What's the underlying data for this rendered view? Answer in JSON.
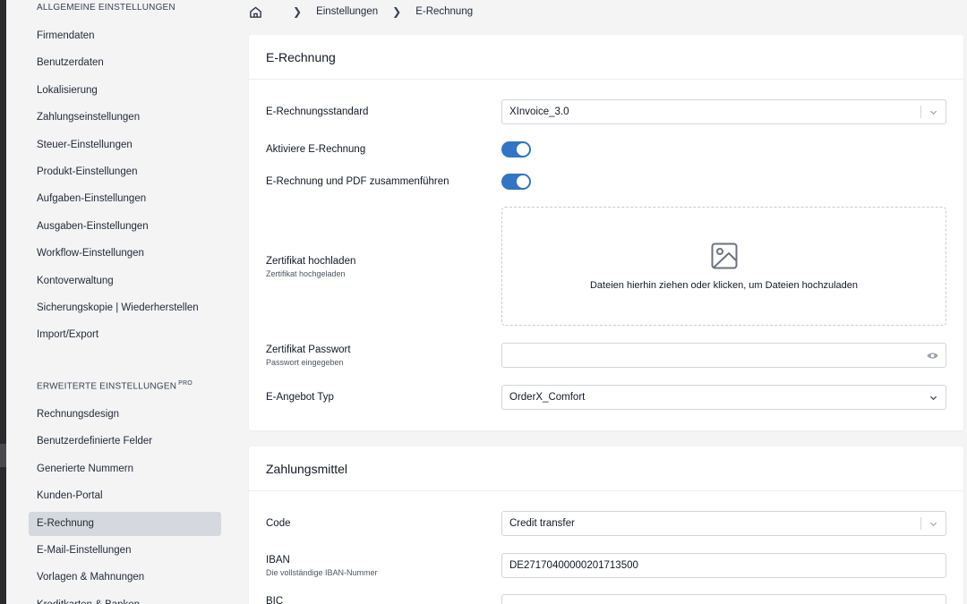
{
  "sidebar": {
    "general_heading": "ALLGEMEINE EINSTELLUNGEN",
    "general_items": [
      "Firmendaten",
      "Benutzerdaten",
      "Lokalisierung",
      "Zahlungseinstellungen",
      "Steuer-Einstellungen",
      "Produkt-Einstellungen",
      "Aufgaben-Einstellungen",
      "Ausgaben-Einstellungen",
      "Workflow-Einstellungen",
      "Kontoverwaltung",
      "Sicherungskopie | Wiederherstellen",
      "Import/Export"
    ],
    "advanced_heading": "ERWEITERTE EINSTELLUNGEN",
    "advanced_badge": "PRO",
    "advanced_items": [
      "Rechnungsdesign",
      "Benutzerdefinierte Felder",
      "Generierte Nummern",
      "Kunden-Portal",
      "E-Rechnung",
      "E-Mail-Einstellungen",
      "Vorlagen & Mahnungen",
      "Kreditkarten & Banken"
    ],
    "active_item": "E-Rechnung"
  },
  "breadcrumb": {
    "home_icon": "home-icon",
    "items": [
      "Einstellungen",
      "E-Rechnung"
    ]
  },
  "einvoice_card": {
    "title": "E-Rechnung",
    "standard": {
      "label": "E-Rechnungsstandard",
      "value": "XInvoice_3.0"
    },
    "activate": {
      "label": "Aktiviere E-Rechnung",
      "enabled": true
    },
    "merge_pdf": {
      "label": "E-Rechnung und PDF zusammenführen",
      "enabled": true
    },
    "certificate": {
      "label": "Zertifikat hochladen",
      "help": "Zertifikat hochgeladen",
      "dropzone_text": "Dateien hierhin ziehen oder klicken, um Dateien hochzuladen"
    },
    "cert_password": {
      "label": "Zertifikat Passwort",
      "help": "Passwort eingegeben",
      "value": ""
    },
    "quote_type": {
      "label": "E-Angebot Typ",
      "value": "OrderX_Comfort"
    }
  },
  "payment_card": {
    "title": "Zahlungsmittel",
    "code": {
      "label": "Code",
      "value": "Credit transfer"
    },
    "iban": {
      "label": "IBAN",
      "help": "Die vollständige IBAN-Nummer",
      "value": "DE27170400000201713500"
    },
    "bic": {
      "label": "BIC"
    }
  },
  "colors": {
    "accent": "#3175c4",
    "active_bg": "#d5d8de",
    "page_bg": "#f4f4f5"
  }
}
